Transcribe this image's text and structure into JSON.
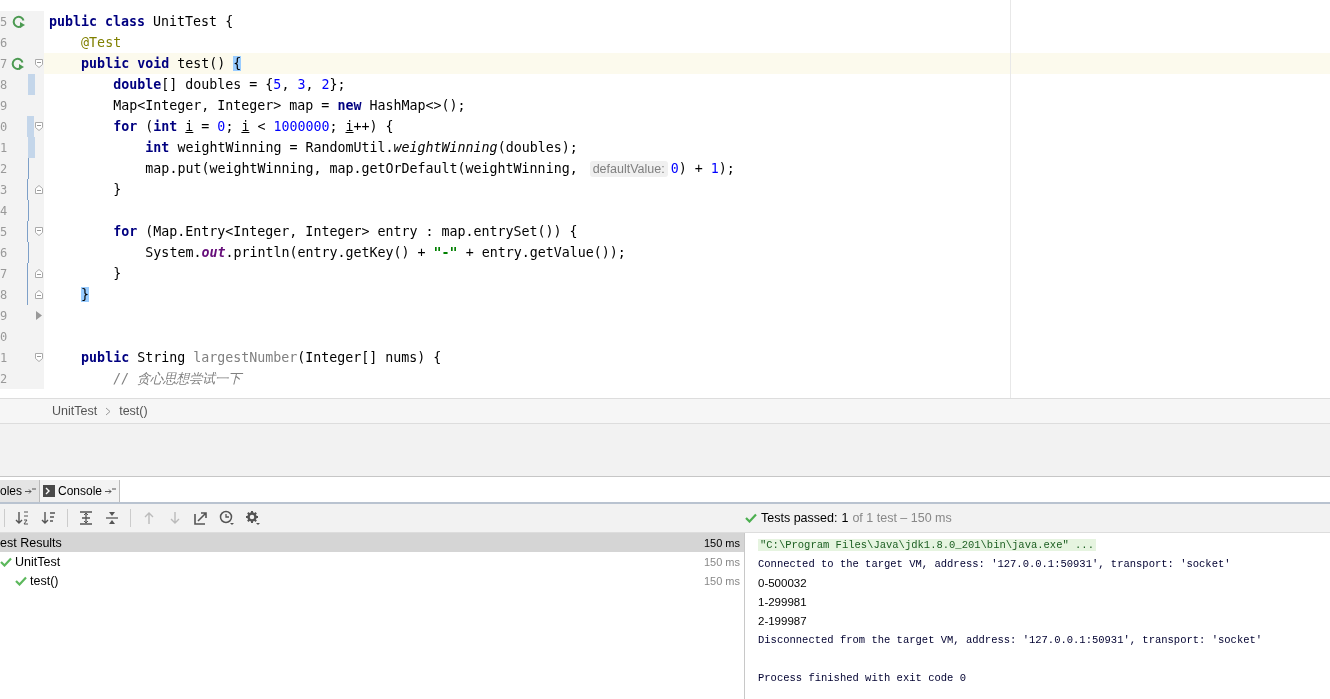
{
  "editor": {
    "lines": [
      {
        "number": "5",
        "run": true,
        "caret": false,
        "code": [
          {
            "kind": "keyword",
            "text": "public class "
          },
          {
            "kind": "plain",
            "text": "UnitTest {"
          }
        ]
      },
      {
        "number": "6",
        "run": false,
        "caret": false,
        "code": [
          {
            "kind": "annotation",
            "text": "    @Test"
          }
        ]
      },
      {
        "number": "7",
        "run": true,
        "caret": true,
        "fold_marker": {
          "kind": "start"
        },
        "code": [
          {
            "kind": "keyword",
            "text": "    public void "
          },
          {
            "kind": "plain",
            "text": "test() "
          },
          {
            "kind": "brace",
            "text": "{"
          }
        ]
      },
      {
        "number": "8",
        "run": false,
        "caret": false,
        "change_marker": {
          "kind": "bar"
        },
        "code": [
          {
            "kind": "keyword",
            "text": "        double"
          },
          {
            "kind": "plain",
            "text": "[] doubles = {"
          },
          {
            "kind": "number",
            "text": "5"
          },
          {
            "kind": "plain",
            "text": ", "
          },
          {
            "kind": "number",
            "text": "3"
          },
          {
            "kind": "plain",
            "text": ", "
          },
          {
            "kind": "number",
            "text": "2"
          },
          {
            "kind": "plain",
            "text": "};"
          }
        ]
      },
      {
        "number": "9",
        "run": false,
        "caret": false,
        "code": [
          {
            "kind": "plain",
            "text": "        Map<Integer, Integer> map = "
          },
          {
            "kind": "keyword",
            "text": "new "
          },
          {
            "kind": "plain",
            "text": "HashMap<>();"
          }
        ]
      },
      {
        "number": "0",
        "run": false,
        "caret": false,
        "fold_marker": {
          "kind": "start"
        },
        "change_marker": {
          "kind": "bar"
        },
        "code": [
          {
            "kind": "keyword",
            "text": "        for "
          },
          {
            "kind": "plain",
            "text": "("
          },
          {
            "kind": "keyword",
            "text": "int "
          },
          {
            "kind": "underlined",
            "text": "i"
          },
          {
            "kind": "plain",
            "text": " = "
          },
          {
            "kind": "number",
            "text": "0"
          },
          {
            "kind": "plain",
            "text": "; "
          },
          {
            "kind": "underlined",
            "text": "i"
          },
          {
            "kind": "plain",
            "text": " < "
          },
          {
            "kind": "number",
            "text": "1000000"
          },
          {
            "kind": "plain",
            "text": "; "
          },
          {
            "kind": "underlined",
            "text": "i"
          },
          {
            "kind": "plain",
            "text": "++) {"
          }
        ]
      },
      {
        "number": "1",
        "run": false,
        "caret": false,
        "change_marker": {
          "kind": "bar"
        },
        "code": [
          {
            "kind": "keyword",
            "text": "            int "
          },
          {
            "kind": "plain",
            "text": "weightWinning = RandomUtil."
          },
          {
            "kind": "italic",
            "text": "weightWinning"
          },
          {
            "kind": "plain",
            "text": "(doubles);"
          }
        ]
      },
      {
        "number": "2",
        "run": false,
        "caret": false,
        "change_marker": {
          "kind": "line"
        },
        "code": [
          {
            "kind": "plain",
            "text": "            map.put(weightWinning, map.getOrDefault(weightWinning, "
          },
          {
            "kind": "hint",
            "text": "defaultValue:"
          },
          {
            "kind": "number",
            "text": "0"
          },
          {
            "kind": "plain",
            "text": ") + "
          },
          {
            "kind": "number",
            "text": "1"
          },
          {
            "kind": "plain",
            "text": ");"
          }
        ]
      },
      {
        "number": "3",
        "run": false,
        "caret": false,
        "fold_marker": {
          "kind": "end"
        },
        "change_marker": {
          "kind": "line"
        },
        "code": [
          {
            "kind": "plain",
            "text": "        }"
          }
        ]
      },
      {
        "number": "4",
        "run": false,
        "caret": false,
        "change_marker": {
          "kind": "line"
        }
      },
      {
        "number": "5",
        "run": false,
        "caret": false,
        "fold_marker": {
          "kind": "start"
        },
        "change_marker": {
          "kind": "line"
        },
        "code": [
          {
            "kind": "keyword",
            "text": "        for "
          },
          {
            "kind": "plain",
            "text": "(Map.Entry<Integer, Integer> entry : map.entrySet()) {"
          }
        ]
      },
      {
        "number": "6",
        "run": false,
        "caret": false,
        "change_marker": {
          "kind": "line"
        },
        "code": [
          {
            "kind": "plain",
            "text": "            System."
          },
          {
            "kind": "static",
            "text": "out"
          },
          {
            "kind": "plain",
            "text": ".println(entry.getKey() + "
          },
          {
            "kind": "string",
            "text": "\"-\""
          },
          {
            "kind": "plain",
            "text": " + entry.getValue());"
          }
        ]
      },
      {
        "number": "7",
        "run": false,
        "caret": false,
        "fold_marker": {
          "kind": "end"
        },
        "change_marker": {
          "kind": "line"
        },
        "code": [
          {
            "kind": "plain",
            "text": "        }"
          }
        ]
      },
      {
        "number": "8",
        "run": false,
        "caret": false,
        "fold_marker": {
          "kind": "end"
        },
        "change_marker": {
          "kind": "line"
        },
        "code": [
          {
            "kind": "brace",
            "text": "    }"
          }
        ]
      },
      {
        "number": "9",
        "run": false,
        "caret": false,
        "fold_marker": {
          "kind": "arrow"
        }
      },
      {
        "number": "0",
        "run": false,
        "caret": false
      },
      {
        "number": "1",
        "run": false,
        "caret": false,
        "fold_marker": {
          "kind": "start"
        },
        "code": [
          {
            "kind": "keyword",
            "text": "    public "
          },
          {
            "kind": "plain",
            "text": "String "
          },
          {
            "kind": "unused",
            "text": "largestNumber"
          },
          {
            "kind": "plain",
            "text": "(Integer[] nums) {"
          }
        ]
      },
      {
        "number": "2",
        "run": false,
        "caret": false,
        "code": [
          {
            "kind": "comment",
            "text": "        // 贪心思想尝试一下"
          }
        ]
      }
    ]
  },
  "breadcrumbs": [
    "UnitTest",
    "test()"
  ],
  "tool_tabs": [
    {
      "label": "oles",
      "selected": false
    },
    {
      "label": "Console",
      "selected": true
    }
  ],
  "status": {
    "label": "Tests passed:",
    "count": "1",
    "detail": "of 1 test – 150 ms"
  },
  "test_tree": {
    "label": "est Results",
    "time": "150 ms",
    "children": [
      {
        "label": "UnitTest",
        "passed": true,
        "time": "150 ms",
        "children": [
          {
            "label": "test()",
            "passed": true,
            "time": "150 ms"
          }
        ]
      }
    ]
  },
  "console": [
    {
      "kind": "command",
      "text": "\"C:\\Program Files\\Java\\jdk1.8.0_201\\bin\\java.exe\" ..."
    },
    {
      "kind": "system",
      "text": "Connected to the target VM, address: '127.0.0.1:50931', transport: 'socket'"
    },
    {
      "kind": "output",
      "text": "0-500032"
    },
    {
      "kind": "output",
      "text": "1-299981"
    },
    {
      "kind": "output",
      "text": "2-199987"
    },
    {
      "kind": "system",
      "text": "Disconnected from the target VM, address: '127.0.0.1:50931', transport: 'socket'"
    },
    {
      "kind": "blank"
    },
    {
      "kind": "system",
      "text": "Process finished with exit code 0"
    }
  ]
}
